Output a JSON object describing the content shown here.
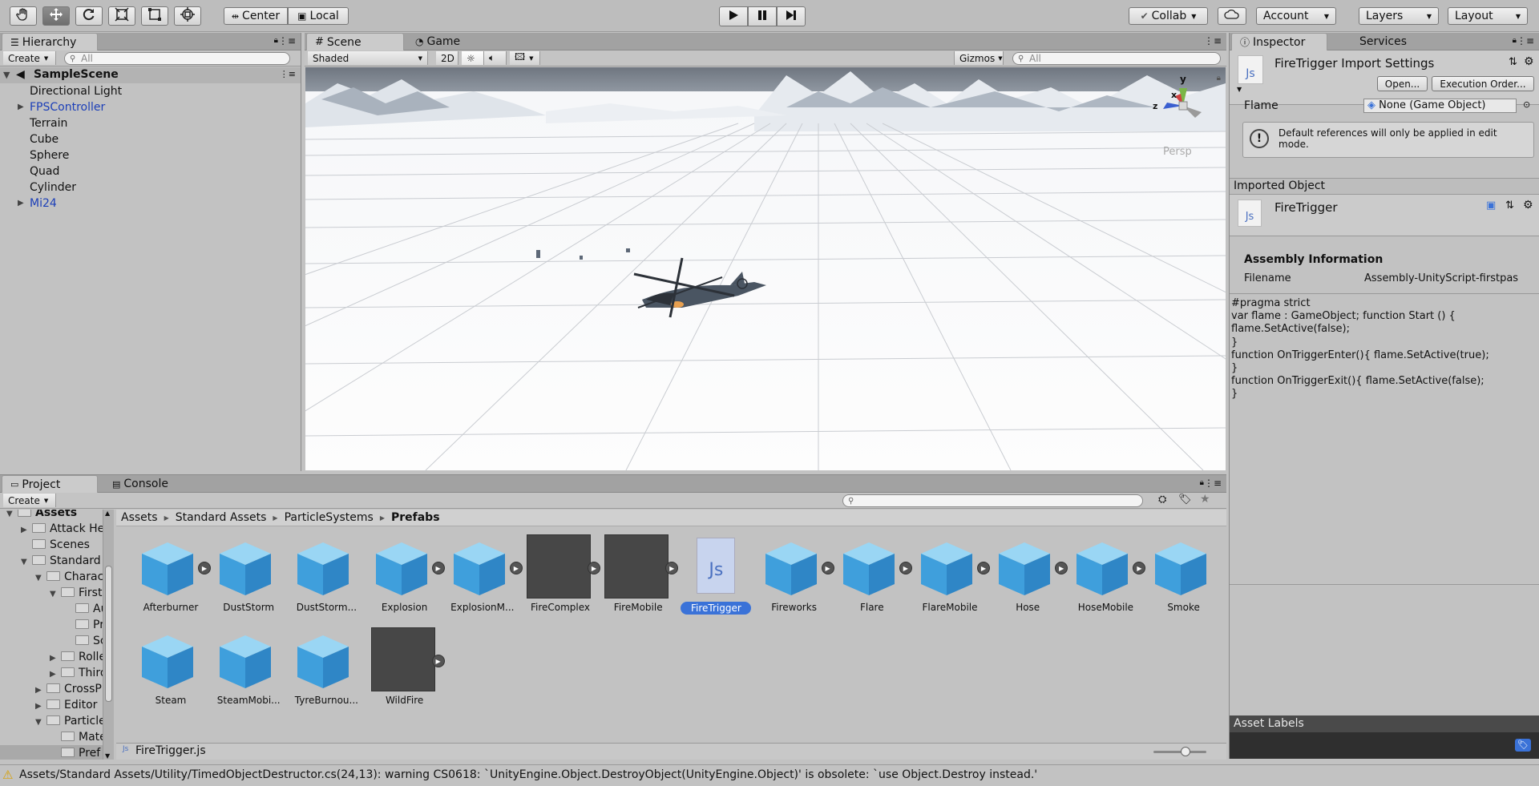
{
  "toolbar": {
    "center_label": "Center",
    "local_label": "Local",
    "collab_label": "Collab",
    "account_label": "Account",
    "layers_label": "Layers",
    "layout_label": "Layout"
  },
  "hierarchy": {
    "tab_label": "Hierarchy",
    "create_label": "Create",
    "search_placeholder": "All",
    "scene_name": "SampleScene",
    "items": [
      {
        "label": "Directional Light",
        "prefab": false,
        "expandable": false
      },
      {
        "label": "FPSController",
        "prefab": true,
        "expandable": true
      },
      {
        "label": "Terrain",
        "prefab": false,
        "expandable": false
      },
      {
        "label": "Cube",
        "prefab": false,
        "expandable": false
      },
      {
        "label": "Sphere",
        "prefab": false,
        "expandable": false
      },
      {
        "label": "Quad",
        "prefab": false,
        "expandable": false
      },
      {
        "label": "Cylinder",
        "prefab": false,
        "expandable": false
      },
      {
        "label": "Mi24",
        "prefab": true,
        "expandable": true
      }
    ]
  },
  "scene": {
    "tab_scene": "Scene",
    "tab_game": "Game",
    "shading_mode": "Shaded",
    "mode_2d": "2D",
    "gizmos_label": "Gizmos",
    "search_placeholder": "All",
    "persp_label": "Persp",
    "axis_y": "y",
    "axis_x": "x",
    "axis_z": "z"
  },
  "inspector": {
    "tab_inspector": "Inspector",
    "tab_services": "Services",
    "file_icon_text": "Js",
    "title": "FireTrigger Import Settings",
    "open_button": "Open...",
    "exec_order_button": "Execution Order...",
    "field_label": "Flame",
    "field_value": "None (Game Object)",
    "help_text": "Default references will only be applied in edit mode.",
    "imported_object_header": "Imported Object",
    "imported_name": "FireTrigger",
    "assembly_header": "Assembly Information",
    "filename_label": "Filename",
    "filename_value": "Assembly-UnityScript-firstpas",
    "code_lines": [
      "#pragma strict",
      "var flame : GameObject; function Start () {",
      "flame.SetActive(false);",
      "}",
      "function OnTriggerEnter(){ flame.SetActive(true);",
      "}",
      "function OnTriggerExit(){ flame.SetActive(false);",
      "}"
    ],
    "asset_labels_header": "Asset Labels"
  },
  "project": {
    "tab_project": "Project",
    "tab_console": "Console",
    "create_label": "Create",
    "tree": [
      {
        "label": "Assets",
        "depth": 0,
        "arrow": "down",
        "bold": true
      },
      {
        "label": "Attack He",
        "depth": 1,
        "arrow": "right"
      },
      {
        "label": "Scenes",
        "depth": 1,
        "arrow": "none"
      },
      {
        "label": "Standard",
        "depth": 1,
        "arrow": "down"
      },
      {
        "label": "Charac",
        "depth": 2,
        "arrow": "down"
      },
      {
        "label": "First",
        "depth": 3,
        "arrow": "down"
      },
      {
        "label": "Au",
        "depth": 4,
        "arrow": "none"
      },
      {
        "label": "Pr",
        "depth": 4,
        "arrow": "none"
      },
      {
        "label": "Sc",
        "depth": 4,
        "arrow": "none"
      },
      {
        "label": "Rolle",
        "depth": 3,
        "arrow": "right"
      },
      {
        "label": "Third",
        "depth": 3,
        "arrow": "right"
      },
      {
        "label": "CrossP",
        "depth": 2,
        "arrow": "right"
      },
      {
        "label": "Editor",
        "depth": 2,
        "arrow": "right"
      },
      {
        "label": "Particle",
        "depth": 2,
        "arrow": "down"
      },
      {
        "label": "Mate",
        "depth": 3,
        "arrow": "none"
      },
      {
        "label": "Pref",
        "depth": 3,
        "arrow": "none",
        "selected": true
      }
    ],
    "breadcrumb": [
      "Assets",
      "Standard Assets",
      "ParticleSystems",
      "Prefabs"
    ],
    "assets": [
      {
        "label": "Afterburner",
        "kind": "cube",
        "play": true
      },
      {
        "label": "DustStorm",
        "kind": "cube",
        "play": false
      },
      {
        "label": "DustStorm...",
        "kind": "cube",
        "play": false
      },
      {
        "label": "Explosion",
        "kind": "cube",
        "play": true
      },
      {
        "label": "ExplosionM...",
        "kind": "cube",
        "play": true
      },
      {
        "label": "FireComplex",
        "kind": "dark",
        "play": true
      },
      {
        "label": "FireMobile",
        "kind": "dark",
        "play": true
      },
      {
        "label": "FireTrigger",
        "kind": "script",
        "play": false,
        "selected": true
      },
      {
        "label": "Fireworks",
        "kind": "cube",
        "play": true
      },
      {
        "label": "Flare",
        "kind": "cube",
        "play": true
      },
      {
        "label": "FlareMobile",
        "kind": "cube",
        "play": true
      },
      {
        "label": "Hose",
        "kind": "cube",
        "play": true
      },
      {
        "label": "HoseMobile",
        "kind": "cube",
        "play": true
      },
      {
        "label": "Smoke",
        "kind": "cube",
        "play": false
      },
      {
        "label": "Steam",
        "kind": "cube",
        "play": false
      },
      {
        "label": "SteamMobi...",
        "kind": "cube",
        "play": false
      },
      {
        "label": "TyreBurnou...",
        "kind": "cube",
        "play": false
      },
      {
        "label": "WildFire",
        "kind": "dark",
        "play": true
      }
    ],
    "selected_file": "FireTrigger.js"
  },
  "status_bar": {
    "message": "Assets/Standard Assets/Utility/TimedObjectDestructor.cs(24,13): warning CS0618: `UnityEngine.Object.DestroyObject(UnityEngine.Object)' is obsolete: `use Object.Destroy instead.'"
  },
  "colors": {
    "selection_blue": "#3a72d8",
    "prefab_text": "#1c3fb8",
    "panel_bg": "#c2c2c2"
  }
}
